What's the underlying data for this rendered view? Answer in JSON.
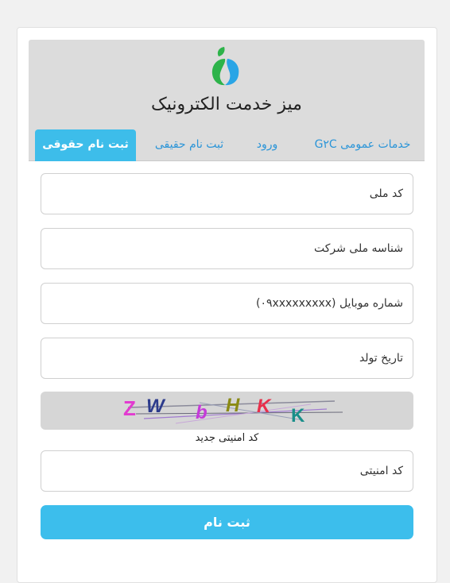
{
  "header": {
    "title": "میز خدمت الکترونیک",
    "logo_icon": "leaf-drop-logo",
    "colors": {
      "logo_green": "#2db34a",
      "logo_blue": "#2aa5e6"
    }
  },
  "tabs": [
    {
      "label": "خدمات عمومی G۲C",
      "active": false
    },
    {
      "label": "ورود",
      "active": false
    },
    {
      "label": "ثبت نام حقیقی",
      "active": false
    },
    {
      "label": "ثبت نام حقوقی",
      "active": true
    }
  ],
  "form": {
    "national_code_placeholder": "کد ملی",
    "company_id_placeholder": "شناسه ملی شرکت",
    "mobile_placeholder": "شماره موبایل (۰۹xxxxxxxxx)",
    "birthdate_placeholder": "تاریخ تولد",
    "captcha_text": [
      "Z",
      "W",
      "b",
      "H",
      "K",
      "K"
    ],
    "captcha_refresh_label": "کد امنیتی جدید",
    "captcha_input_placeholder": "کد امنیتی",
    "submit_label": "ثبت نام"
  },
  "colors": {
    "accent": "#3cbeec",
    "tab_link": "#2b95d8"
  }
}
